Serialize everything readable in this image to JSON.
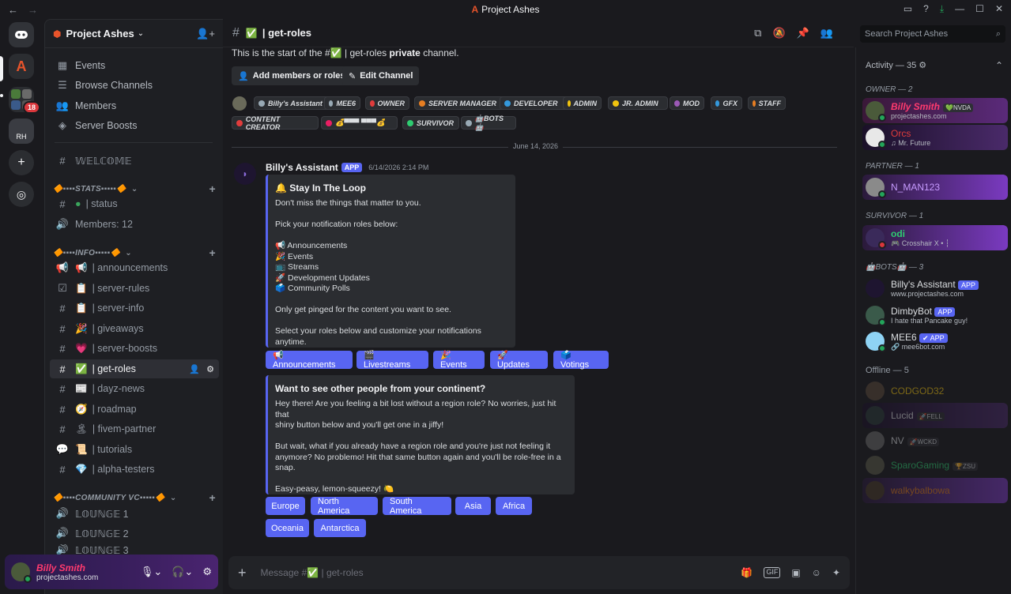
{
  "window": {
    "title": "Project Ashes",
    "logo": "A"
  },
  "servers": {
    "rh_label": "RH",
    "folder_badge": "18"
  },
  "server": {
    "name": "Project Ashes"
  },
  "nav": [
    {
      "label": "Events",
      "icon": "calendar-icon"
    },
    {
      "label": "Browse Channels",
      "icon": "browse-icon"
    },
    {
      "label": "Members",
      "icon": "members-icon"
    },
    {
      "label": "Server Boosts",
      "icon": "boost-icon"
    }
  ],
  "channels": {
    "welcome": "𝕎𝔼𝕃ℂ𝕆𝕄𝔼",
    "stats_category": "🔶▪▪▪▪STATS▪▪▪▪▪🔶",
    "status": "| status",
    "members_count": "Members: 12",
    "info_category": "🔶▪▪▪▪INFO▪▪▪▪▪🔶",
    "announcements": "| announcements",
    "server_rules": "| server-rules",
    "server_info": "| server-info",
    "giveaways": "| giveaways",
    "server_boosts": "| server-boosts",
    "get_roles": "| get-roles",
    "dayz_news": "| dayz-news",
    "roadmap": "| roadmap",
    "fivem_partner": "| fivem-partner",
    "tutorials": "| tutorials",
    "alpha_testers": "| alpha-testers",
    "community_category": "🔶▪▪▪▪COMMUNITY VC▪▪▪▪▪🔶",
    "lounge1": "𝕃𝕆𝕌ℕ𝔾𝔼 1",
    "lounge2": "𝕃𝕆𝕌ℕ𝔾𝔼 2",
    "lounge3": "𝕃𝕆𝕌ℕ𝔾𝔼 3"
  },
  "user": {
    "name": "Billy Smith",
    "sub": "projectashes.com"
  },
  "header": {
    "channel": "| get-roles",
    "search_placeholder": "Search Project Ashes"
  },
  "intro": {
    "start_text": "This is the start of the #✅ | get-roles",
    "private_word": "private",
    "channel_word": "channel.",
    "add_members": "Add members or roles",
    "edit_channel": "Edit Channel"
  },
  "roles": [
    {
      "label": "Billy's Assistant",
      "color": "#99aab5"
    },
    {
      "label": "MEE6",
      "color": "#99aab5"
    },
    {
      "label": "OWNER",
      "color": "#e03c3c"
    },
    {
      "label": "SERVER MANAGER",
      "color": "#e67e22"
    },
    {
      "label": "DEVELOPER",
      "color": "#3498db"
    },
    {
      "label": "ADMIN",
      "color": "#f1c40f"
    },
    {
      "label": "JR. ADMIN",
      "color": "#f1c40f"
    },
    {
      "label": "MOD",
      "color": "#9b59b6"
    },
    {
      "label": "GFX",
      "color": "#3498db"
    },
    {
      "label": "STAFF",
      "color": "#e67e22"
    },
    {
      "label": "CONTENT CREATOR",
      "color": "#e03c3c"
    },
    {
      "label": "💰▀▀▀ ▀▀▀💰",
      "color": "#e91e63"
    },
    {
      "label": "SURVIVOR",
      "color": "#2ecc71"
    },
    {
      "label": "🤖BOTS🤖",
      "color": "#99aab5"
    }
  ],
  "date_separator": "June 14, 2026",
  "message": {
    "author": "Billy's Assistant",
    "app_badge": "APP",
    "timestamp": "6/14/2026 2:14 PM"
  },
  "embed1": {
    "title": "🔔 Stay In The Loop",
    "lines": [
      "Don't miss the things that matter to you.",
      "",
      "Pick your notification roles below:",
      "",
      "📢 Announcements",
      "🎉 Events",
      "📺 Streams",
      "🚀 Development Updates",
      "🗳️ Community Polls",
      "",
      "Only get pinged for the content you want to see.",
      "",
      "Select your roles below and customize your notifications anytime."
    ]
  },
  "notif_buttons": [
    "📢 Announcements",
    "🎬 Livestreams",
    "🎉 Events",
    "🚀 Updates",
    "🗳️ Votings"
  ],
  "embed2": {
    "title": "Want to see other people from your continent?",
    "lines": [
      "Hey there! Are you feeling a bit lost without a region role? No worries, just hit that",
      "shiny button below and you'll get one in a jiffy!",
      "",
      "But wait, what if you already have a region role and you're just not feeling it",
      "anymore? No problemo! Hit that same button again and you'll be role-free in a",
      "snap.",
      "",
      "Easy-peasy, lemon-squeezy! 🍋"
    ]
  },
  "region_buttons": [
    "Europe",
    "North America",
    "South America",
    "Asia",
    "Africa",
    "Oceania",
    "Antarctica"
  ],
  "composer": {
    "placeholder": "Message #✅ | get-roles"
  },
  "member_list": {
    "activity": "Activity — 35",
    "owner_group": "OWNER — 2",
    "partner_group": "PARTNER — 1",
    "survivor_group": "SURVIVOR — 1",
    "bots_group": "🤖BOTS🤖 — 3",
    "offline_group": "Offline — 5",
    "members": [
      {
        "name": "Billy Smith",
        "tag": "💚NVDA",
        "sub": "projectashes.com",
        "color": "#ff3a6e"
      },
      {
        "name": "Orcs",
        "sub": "♫ Mr. Future",
        "color": "#e03c3c"
      },
      {
        "name": "N_MAN123",
        "sub": "",
        "color": "#c79bff"
      },
      {
        "name": "odi",
        "sub": "🎮 Crosshair X • ┆",
        "color": "#2ecc71"
      },
      {
        "name": "Billy's Assistant",
        "badge": "APP",
        "sub": "www.projectashes.com",
        "color": "#dbdee1"
      },
      {
        "name": "DimbyBot",
        "badge": "APP",
        "sub": "I hate that Pancake guy!",
        "color": "#dbdee1"
      },
      {
        "name": "MEE6",
        "badge": "✔ APP",
        "sub": "🔗 mee6bot.com",
        "color": "#dbdee1"
      },
      {
        "name": "CODGOD32",
        "color": "#f1c40f"
      },
      {
        "name": "Lucid",
        "tag": "🚀FELL",
        "color": "#dbdee1"
      },
      {
        "name": "NV",
        "tag": "🚀WCKD",
        "color": "#dbdee1"
      },
      {
        "name": "SparoGaming",
        "tag": "🏆ZSU",
        "color": "#2ecc71"
      },
      {
        "name": "walkybalbowa",
        "color": "#e67e22"
      }
    ]
  }
}
